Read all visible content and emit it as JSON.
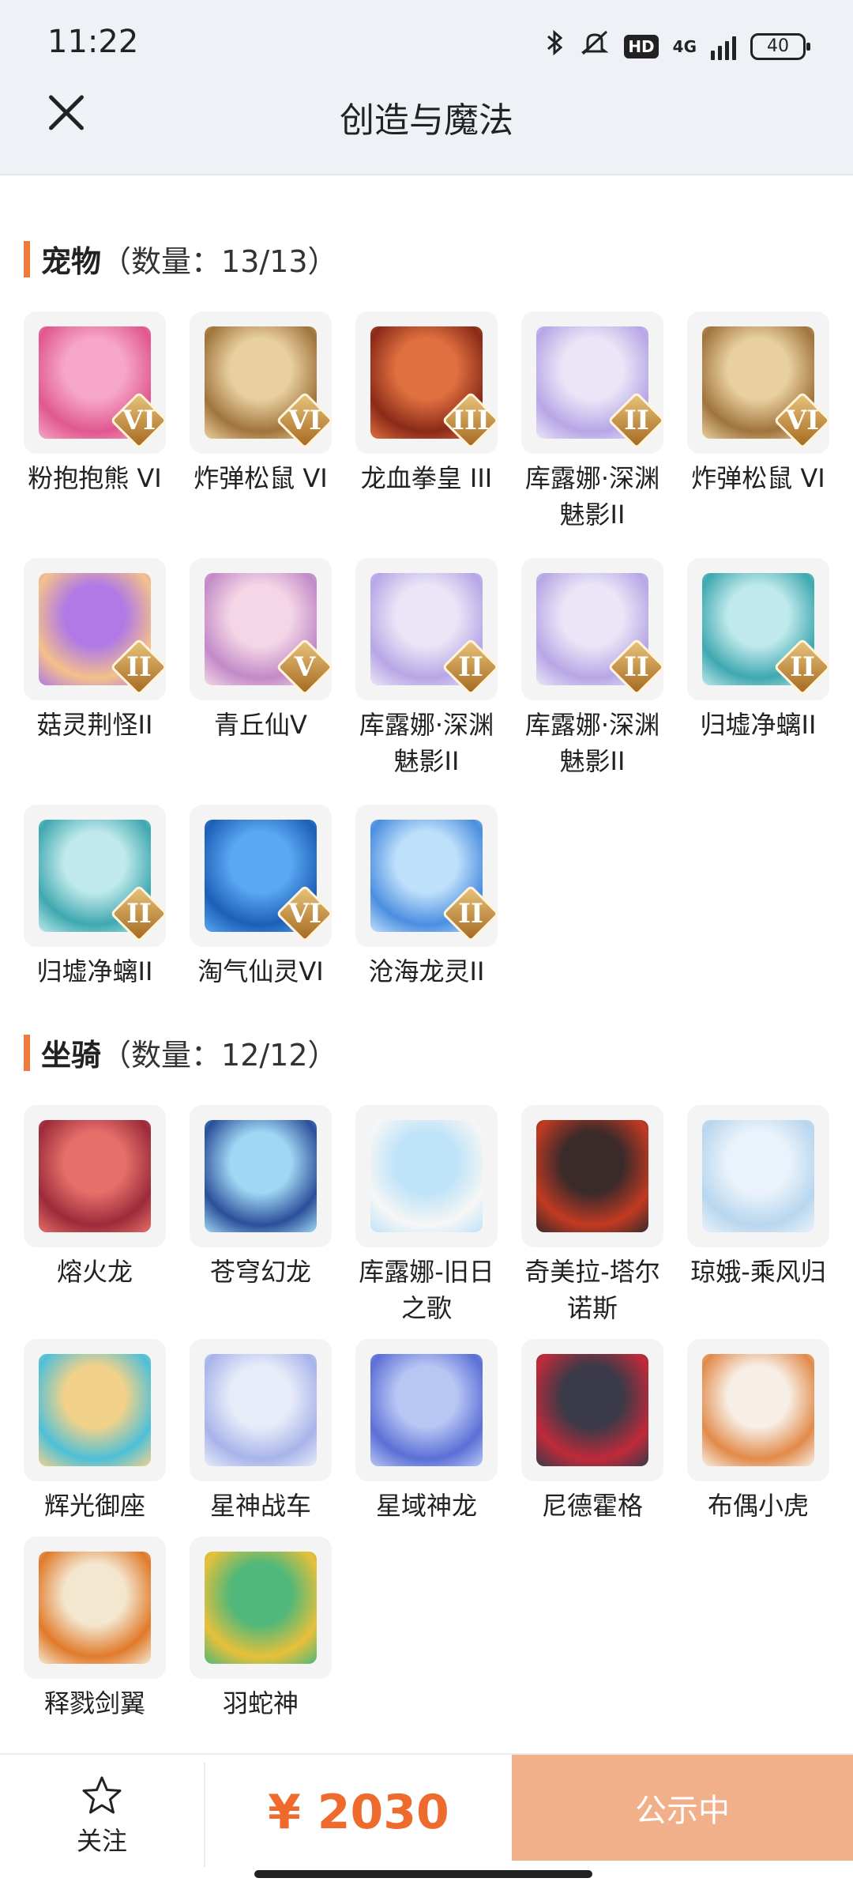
{
  "status_bar": {
    "time": "11:22",
    "network": "4G",
    "hd": "HD",
    "battery": "40"
  },
  "header": {
    "title": "创造与魔法"
  },
  "pets": {
    "title": "宠物",
    "count": "（数量：13/13）",
    "items": [
      {
        "name": "粉抱抱熊 VI",
        "badge": "VI",
        "art": "pink-bear",
        "colors": [
          "#f6a6c7",
          "#e0588f"
        ]
      },
      {
        "name": "炸弹松鼠 VI",
        "badge": "VI",
        "art": "bomb-squirrel",
        "colors": [
          "#e9d0a0",
          "#a0743c"
        ]
      },
      {
        "name": "龙血拳皇 III",
        "badge": "III",
        "art": "dragon-blood-fist",
        "colors": [
          "#e07040",
          "#8a2a18"
        ]
      },
      {
        "name": "库露娜·深渊魅影II",
        "badge": "II",
        "art": "kuluna-abyss",
        "colors": [
          "#eae6f7",
          "#b7a6e6"
        ]
      },
      {
        "name": "炸弹松鼠 VI",
        "badge": "VI",
        "art": "bomb-squirrel",
        "colors": [
          "#e9d0a0",
          "#a0743c"
        ]
      },
      {
        "name": "菇灵荆怪II",
        "badge": "II",
        "art": "mushroom-spirit",
        "colors": [
          "#b07ae6",
          "#f4c08a"
        ]
      },
      {
        "name": "青丘仙V",
        "badge": "V",
        "art": "qingqiu-fairy",
        "colors": [
          "#f4d6e6",
          "#c28ac8"
        ]
      },
      {
        "name": "库露娜·深渊魅影II",
        "badge": "II",
        "art": "kuluna-abyss",
        "colors": [
          "#eae6f7",
          "#b7a6e6"
        ]
      },
      {
        "name": "库露娜·深渊魅影II",
        "badge": "II",
        "art": "kuluna-abyss",
        "colors": [
          "#eae6f7",
          "#b7a6e6"
        ]
      },
      {
        "name": "归墟净螭II",
        "badge": "II",
        "art": "guixu-dragon",
        "colors": [
          "#bfe9ec",
          "#3fa8b0"
        ]
      },
      {
        "name": "归墟净螭II",
        "badge": "II",
        "art": "guixu-dragon",
        "colors": [
          "#bfe9ec",
          "#3fa8b0"
        ]
      },
      {
        "name": "淘气仙灵VI",
        "badge": "VI",
        "art": "naughty-sprite",
        "colors": [
          "#5aa8f2",
          "#1c5fb8"
        ]
      },
      {
        "name": "沧海龙灵II",
        "badge": "II",
        "art": "sea-dragon-spirit",
        "colors": [
          "#bfe0fb",
          "#4b8ee0"
        ]
      }
    ]
  },
  "mounts": {
    "title": "坐骑",
    "count": "（数量：12/12）",
    "items": [
      {
        "name": "熔火龙",
        "art": "molten-dragon",
        "colors": [
          "#e66f6a",
          "#9b2b3a"
        ]
      },
      {
        "name": "苍穹幻龙",
        "art": "sky-phantom-dragon",
        "colors": [
          "#9fd7f4",
          "#2b4f9a"
        ]
      },
      {
        "name": "库露娜-旧日之歌",
        "art": "kuluna-old-song",
        "colors": [
          "#bfe3f8",
          "#f6f6f6"
        ]
      },
      {
        "name": "奇美拉-塔尔诺斯",
        "art": "chimera-tarnos",
        "colors": [
          "#3a2a2a",
          "#c23a22"
        ]
      },
      {
        "name": "琼娥-乘风归",
        "art": "qiong-e",
        "colors": [
          "#eaf3fb",
          "#b8d6ee"
        ]
      },
      {
        "name": "辉光御座",
        "art": "radiant-throne",
        "colors": [
          "#f2d28a",
          "#4ec0d8"
        ]
      },
      {
        "name": "星神战车",
        "art": "star-chariot",
        "colors": [
          "#e8ecf9",
          "#a7b4ea"
        ]
      },
      {
        "name": "星域神龙",
        "art": "star-domain-dragon",
        "colors": [
          "#b8c6f4",
          "#5b6fd6"
        ]
      },
      {
        "name": "尼德霍格",
        "art": "nidhogg",
        "colors": [
          "#3a3a48",
          "#c02a3a"
        ]
      },
      {
        "name": "布偶小虎",
        "art": "rag-doll-tiger",
        "colors": [
          "#f7efe6",
          "#e28a4a"
        ]
      },
      {
        "name": "释戮剑翼",
        "art": "slaughter-sword-wings",
        "colors": [
          "#f4e7d0",
          "#e07a2a"
        ]
      },
      {
        "name": "羽蛇神",
        "art": "feathered-serpent",
        "colors": [
          "#4fb87a",
          "#e8c03a"
        ]
      }
    ]
  },
  "footer": {
    "follow_icon": "star-icon",
    "follow_label": "关注",
    "price": "¥ 2030",
    "status_label": "公示中",
    "accent": "#ee6a2d",
    "status_bg": "#f2b08a"
  }
}
